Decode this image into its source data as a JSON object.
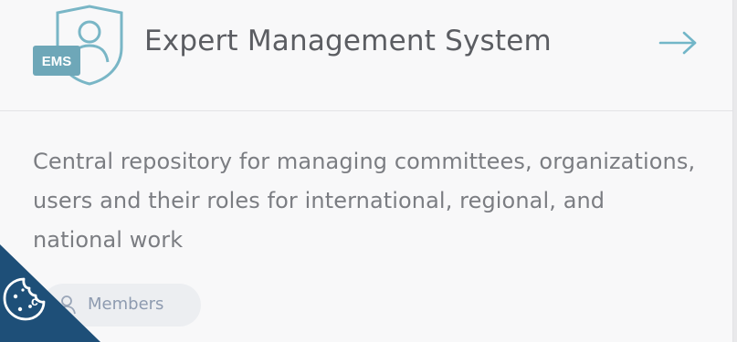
{
  "card": {
    "logo_label": "EMS",
    "title": "Expert Management System",
    "arrow_icon": "arrow-right-icon",
    "description": "Central repository for managing committees, organizations, users and their roles for international, regional, and national work",
    "members_chip": {
      "label": "Members",
      "icon": "user-icon"
    }
  },
  "cookie_button": {
    "icon": "cookie-icon"
  },
  "colors": {
    "accent_teal": "#6fb3c4",
    "title_text": "#5b5d62",
    "body_text": "#7b7d82",
    "chip_text": "#8e9bb0",
    "cookie_banner": "#1e4f78"
  }
}
